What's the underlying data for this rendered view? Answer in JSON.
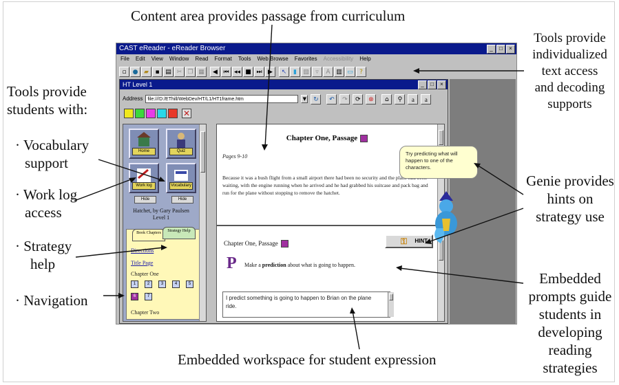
{
  "annotations": {
    "content_area": "Content area provides passage from curriculum",
    "tools_top": [
      "Tools provide",
      "individualized",
      "text access",
      "and decoding",
      "supports"
    ],
    "tools_left": [
      "Tools provide",
      "students with:"
    ],
    "vocab": [
      "· Vocabulary",
      "support"
    ],
    "worklog": [
      "· Work log",
      "access"
    ],
    "strategy": [
      "· Strategy",
      "help"
    ],
    "navigation": "· Navigation",
    "genie": [
      "Genie provides",
      "hints on",
      "strategy use"
    ],
    "prompts": [
      "Embedded",
      "prompts guide",
      "students in",
      "developing",
      "reading",
      "strategies"
    ],
    "workspace": "Embedded workspace for student expression"
  },
  "browser": {
    "title": "CAST eReader - eReader Browser",
    "menu": [
      "File",
      "Edit",
      "View",
      "Window",
      "Read",
      "Format",
      "Tools",
      "Web Browse",
      "Favorites",
      "Help"
    ],
    "menu_dim": "Accessibility",
    "toolbar_icons": [
      "new-page-icon",
      "open-icon",
      "folder-icon",
      "save-icon",
      "print-icon",
      "cut-icon",
      "copy-icon",
      "paste-icon",
      "prev-icon",
      "first-icon",
      "rewind-icon",
      "stop-icon",
      "forward-icon",
      "play-icon",
      "cursor-icon",
      "read-icon",
      "highlight-icon",
      "dim-icon",
      "text-icon",
      "column-icon",
      "window-icon",
      "help-icon"
    ]
  },
  "reader": {
    "title": "HT Level 1",
    "address_label": "Address",
    "address": "file:///D:/EThill/WebDev/HT/L1/HT1frame.htm",
    "swatches": [
      "#f0e81c",
      "#3cd83c",
      "#e83ce8",
      "#2ad8e8",
      "#e83828"
    ],
    "sidebar": {
      "home": "Home",
      "quiz": "Quiz",
      "worklog": "Work log",
      "vocabulary": "Vocabulary",
      "hide1": "Hide",
      "hide2": "Hide",
      "byline": [
        "Hatchet, by Gary Paulsen",
        "Level 1"
      ]
    },
    "nav": {
      "tab1": "Book Chapters",
      "tab2": "Strategy Help",
      "directions": "Directions",
      "title_page": "Title Page",
      "chapter_one": "Chapter One",
      "pages": [
        "1",
        "2",
        "3",
        "4",
        "5",
        "6",
        "7"
      ],
      "chapter_two": "Chapter Two"
    },
    "content": {
      "chapter_title": "Chapter One, Passage",
      "pages": "Pages 9-10",
      "paragraph": "Because it was a bush flight from a small airport there had been no security and the plane had been waiting, with the engine running when he arrived and he had grabbed his suitcase and pack bag and run for the plane without stopping to remove the hatchet."
    },
    "prompt": {
      "chapter": "Chapter One, Passage",
      "hint": "HINT",
      "big_letter": "P",
      "text_pre": "Make a ",
      "text_bold": "prediction",
      "text_post": " about what is going to happen.",
      "workspace": "I predict something is going to happen to Brian on the plane ride."
    },
    "genie_tip": "Try predicting what will happen to one of the characters."
  },
  "colors": {
    "titlebar": "#0a1a8c",
    "badge": "#a030a0",
    "nav_bg": "#fff8b8",
    "sidebar_bg": "#9ea9c8"
  }
}
